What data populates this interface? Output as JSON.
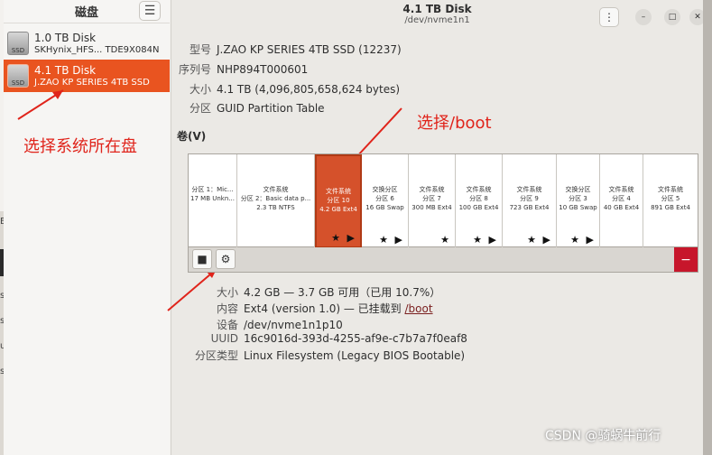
{
  "sidebar": {
    "title": "磁盘",
    "menu_icon": "☰",
    "disks": [
      {
        "icon": "SSD",
        "name": "1.0 TB Disk",
        "sub": "SKHynix_HFS... TDE9X084N"
      },
      {
        "icon": "SSD",
        "name": "4.1 TB Disk",
        "sub": "J.ZAO KP SERIES 4TB SSD"
      }
    ],
    "selected_index": 1
  },
  "window": {
    "title": "4.1 TB Disk",
    "subtitle": "/dev/nvme1n1",
    "kebab": "⋮",
    "minimize": "–",
    "maximize": "□",
    "close": "✕"
  },
  "disk_info": {
    "model_label": "型号",
    "model": "J.ZAO KP SERIES 4TB SSD (12237)",
    "serial_label": "序列号",
    "serial": "NHP894T000601",
    "size_label": "大小",
    "size": "4.1 TB (4,096,805,658,624 bytes)",
    "part_label": "分区",
    "partitioning": "GUID Partition Table"
  },
  "volumes": {
    "title": "卷(V)",
    "partitions": [
      {
        "type": "",
        "name": "分区 1：Mic...",
        "detail": "17 MB Unkn...",
        "stars": ""
      },
      {
        "type": "文件系统",
        "name": "分区 2：Basic data p...",
        "detail": "2.3 TB NTFS",
        "stars": ""
      },
      {
        "type": "文件系统",
        "name": "分区 10",
        "detail": "4.2 GB Ext4",
        "stars": "★ ▶"
      },
      {
        "type": "交换分区",
        "name": "分区 6",
        "detail": "16 GB Swap",
        "stars": "★ ▶"
      },
      {
        "type": "文件系统",
        "name": "分区 7",
        "detail": "300 MB Ext4",
        "stars": "★"
      },
      {
        "type": "文件系统",
        "name": "分区 8",
        "detail": "100 GB Ext4",
        "stars": "★ ▶"
      },
      {
        "type": "文件系统",
        "name": "分区 9",
        "detail": "723 GB Ext4",
        "stars": "★ ▶"
      },
      {
        "type": "交换分区",
        "name": "分区 3",
        "detail": "10 GB Swap",
        "stars": "★ ▶"
      },
      {
        "type": "文件系统",
        "name": "分区 4",
        "detail": "40 GB Ext4",
        "stars": ""
      },
      {
        "type": "文件系统",
        "name": "分区 5",
        "detail": "891 GB Ext4",
        "stars": ""
      }
    ],
    "selected_index": 2,
    "stop_icon": "■",
    "gear_icon": "⚙",
    "delete_icon": "−"
  },
  "volume_info": {
    "size_label": "大小",
    "size": "4.2 GB — 3.7 GB 可用（已用 10.7%）",
    "content_label": "内容",
    "content": "Ext4 (version 1.0) — 已挂载到 ",
    "mount_link": "/boot",
    "device_label": "设备",
    "device": "/dev/nvme1n1p10",
    "uuid_label": "UUID",
    "uuid": "16c9016d-393d-4255-af9e-c7b7a7f0eaf8",
    "ptype_label": "分区类型",
    "ptype": "Linux Filesystem (Legacy BIOS Bootable)"
  },
  "annotations": {
    "select_disk": "选择系统所在盘",
    "select_boot": "选择/boot",
    "color": "#e0241b"
  },
  "background": {
    "fragments": [
      "Ed",
      "sys",
      "ssic",
      "unt",
      "st"
    ]
  },
  "watermark": "CSDN @骑蜗牛前行"
}
